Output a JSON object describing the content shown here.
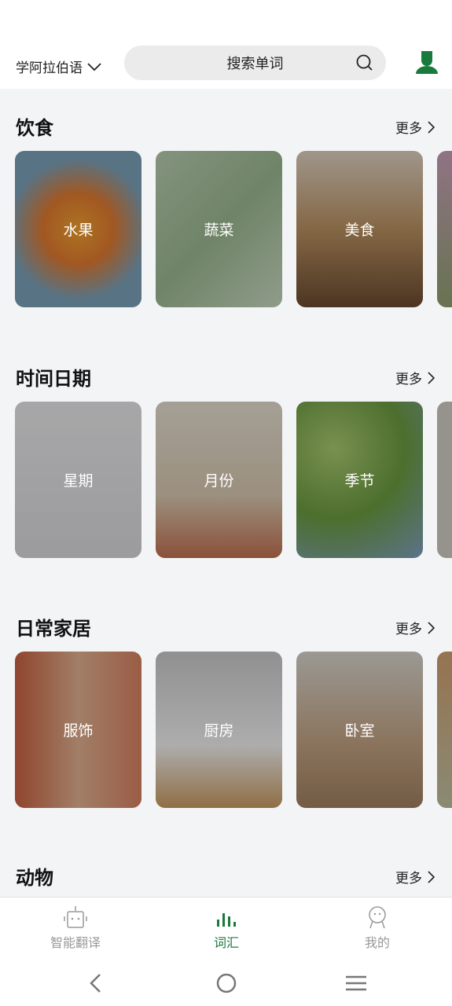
{
  "header": {
    "language": "学阿拉伯语",
    "search_placeholder": "搜索单词"
  },
  "more_label": "更多",
  "sections": [
    {
      "title": "饮食",
      "cards": [
        {
          "label": "水果"
        },
        {
          "label": "蔬菜"
        },
        {
          "label": "美食"
        },
        {
          "label": ""
        }
      ]
    },
    {
      "title": "时间日期",
      "cards": [
        {
          "label": "星期"
        },
        {
          "label": "月份"
        },
        {
          "label": "季节"
        },
        {
          "label": ""
        }
      ]
    },
    {
      "title": "日常家居",
      "cards": [
        {
          "label": "服饰"
        },
        {
          "label": "厨房"
        },
        {
          "label": "卧室"
        },
        {
          "label": ""
        }
      ]
    },
    {
      "title": "动物"
    }
  ],
  "tabs": [
    {
      "label": "智能翻译",
      "icon": "robot-icon"
    },
    {
      "label": "词汇",
      "icon": "bars-icon",
      "active": true
    },
    {
      "label": "我的",
      "icon": "person-icon"
    }
  ],
  "colors": {
    "accent": "#1a7a3c"
  }
}
